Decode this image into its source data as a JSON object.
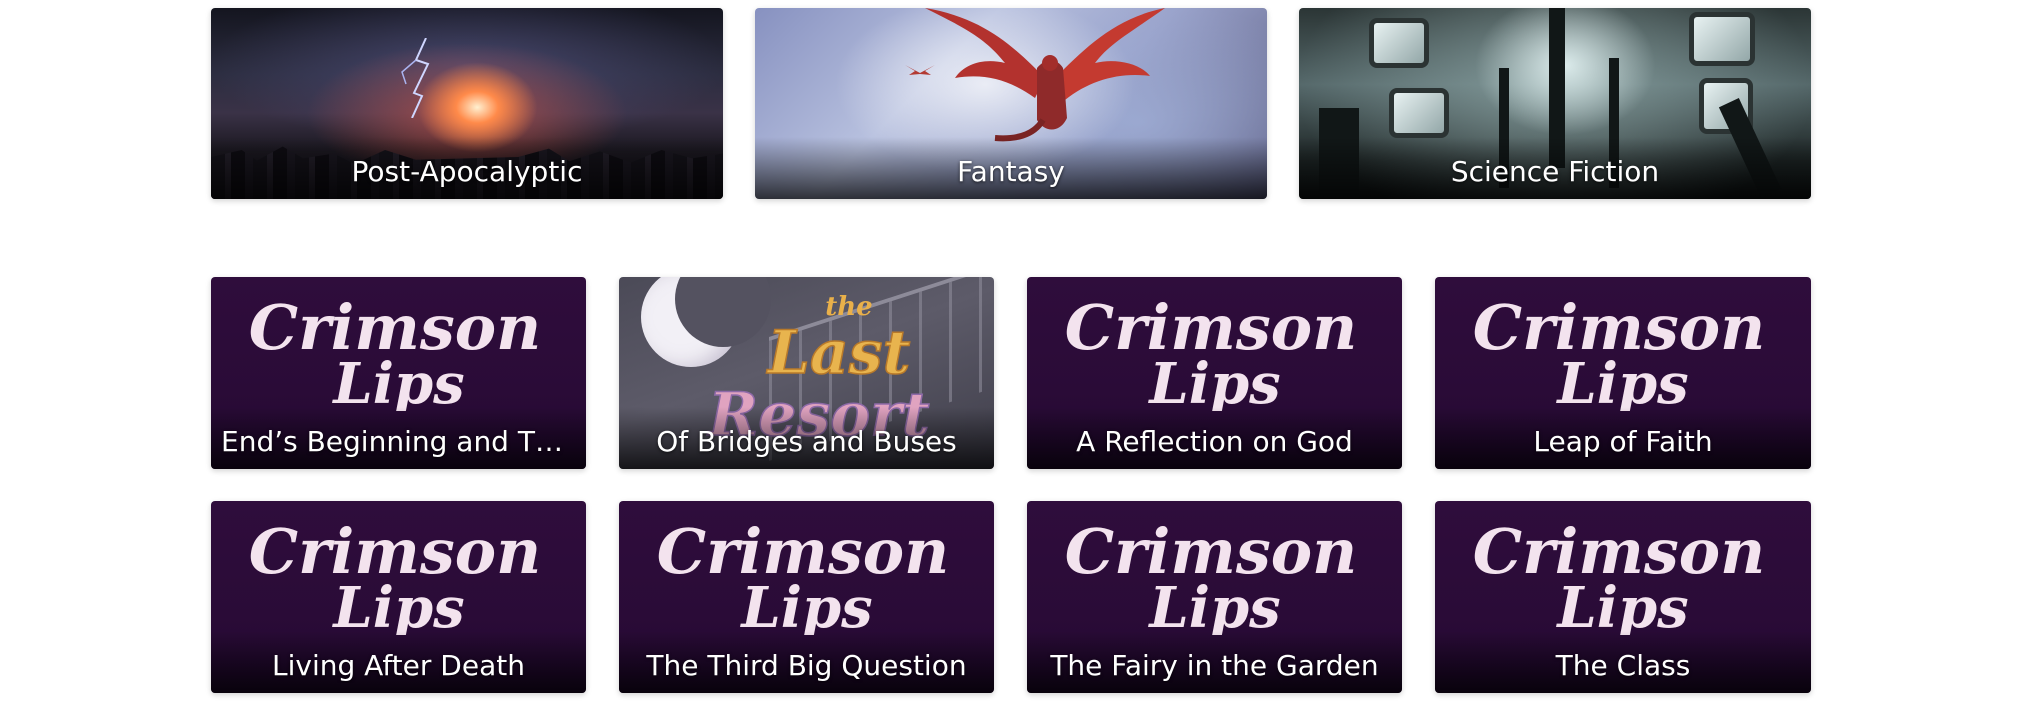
{
  "genres": [
    {
      "label": "Post-Apocalyptic"
    },
    {
      "label": "Fantasy"
    },
    {
      "label": "Science Fiction"
    }
  ],
  "logo": {
    "line1": "Crimson",
    "line2": "Lips",
    "color": "#f3e3ee"
  },
  "resort_logo": {
    "line1": "the",
    "line2": "Last",
    "line3": "Resort"
  },
  "stories": [
    {
      "label": "End’s Beginning and The C..."
    },
    {
      "label": "Of Bridges and Buses"
    },
    {
      "label": "A Reflection on God"
    },
    {
      "label": "Leap of Faith"
    },
    {
      "label": "Living After Death"
    },
    {
      "label": "The Third Big Question"
    },
    {
      "label": "The Fairy in the Garden"
    },
    {
      "label": "The Class"
    }
  ]
}
